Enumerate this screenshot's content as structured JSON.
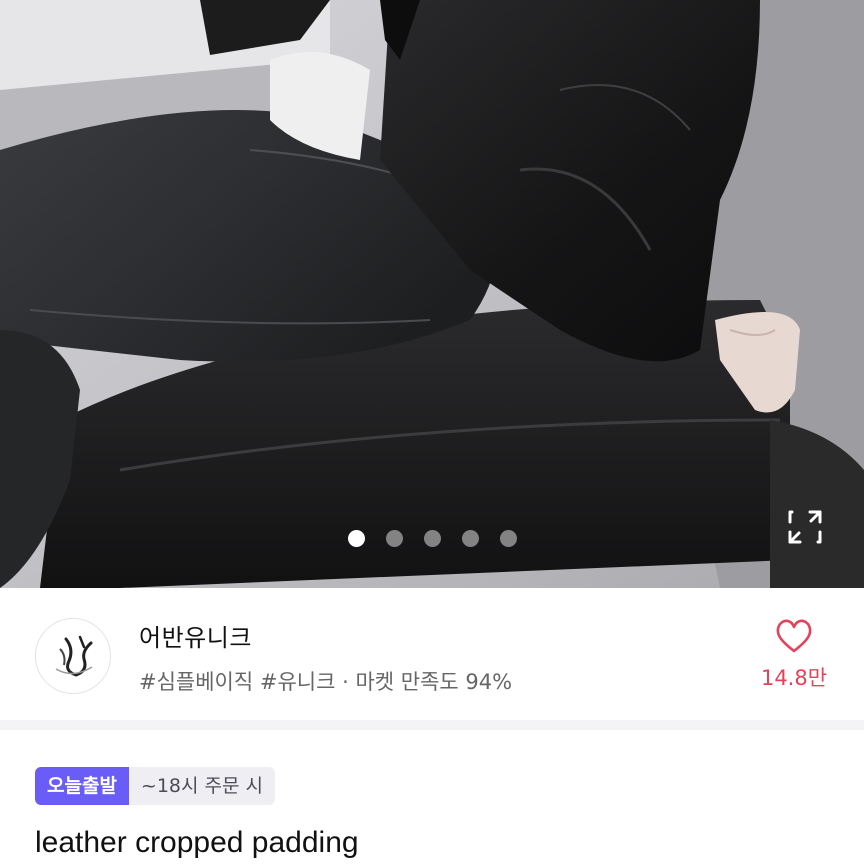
{
  "hero": {
    "icons": {
      "expand": "expand-arrows-icon"
    },
    "pagination": {
      "total": 5,
      "active_index": 0
    }
  },
  "seller": {
    "name": "어반유니크",
    "tags": "#심플베이직 #유니크 · 마켓 만족도 94%",
    "likes": "14.8만",
    "icons": {
      "logo": "store-logo",
      "like": "heart-outline-icon"
    }
  },
  "product": {
    "badge_today": "오늘출발",
    "badge_time": "~18시 주문 시",
    "name": "leather cropped padding"
  },
  "colors": {
    "like": "#e2425b",
    "badge": "#6a5cf6",
    "badge_secondary_bg": "#efeef3"
  }
}
